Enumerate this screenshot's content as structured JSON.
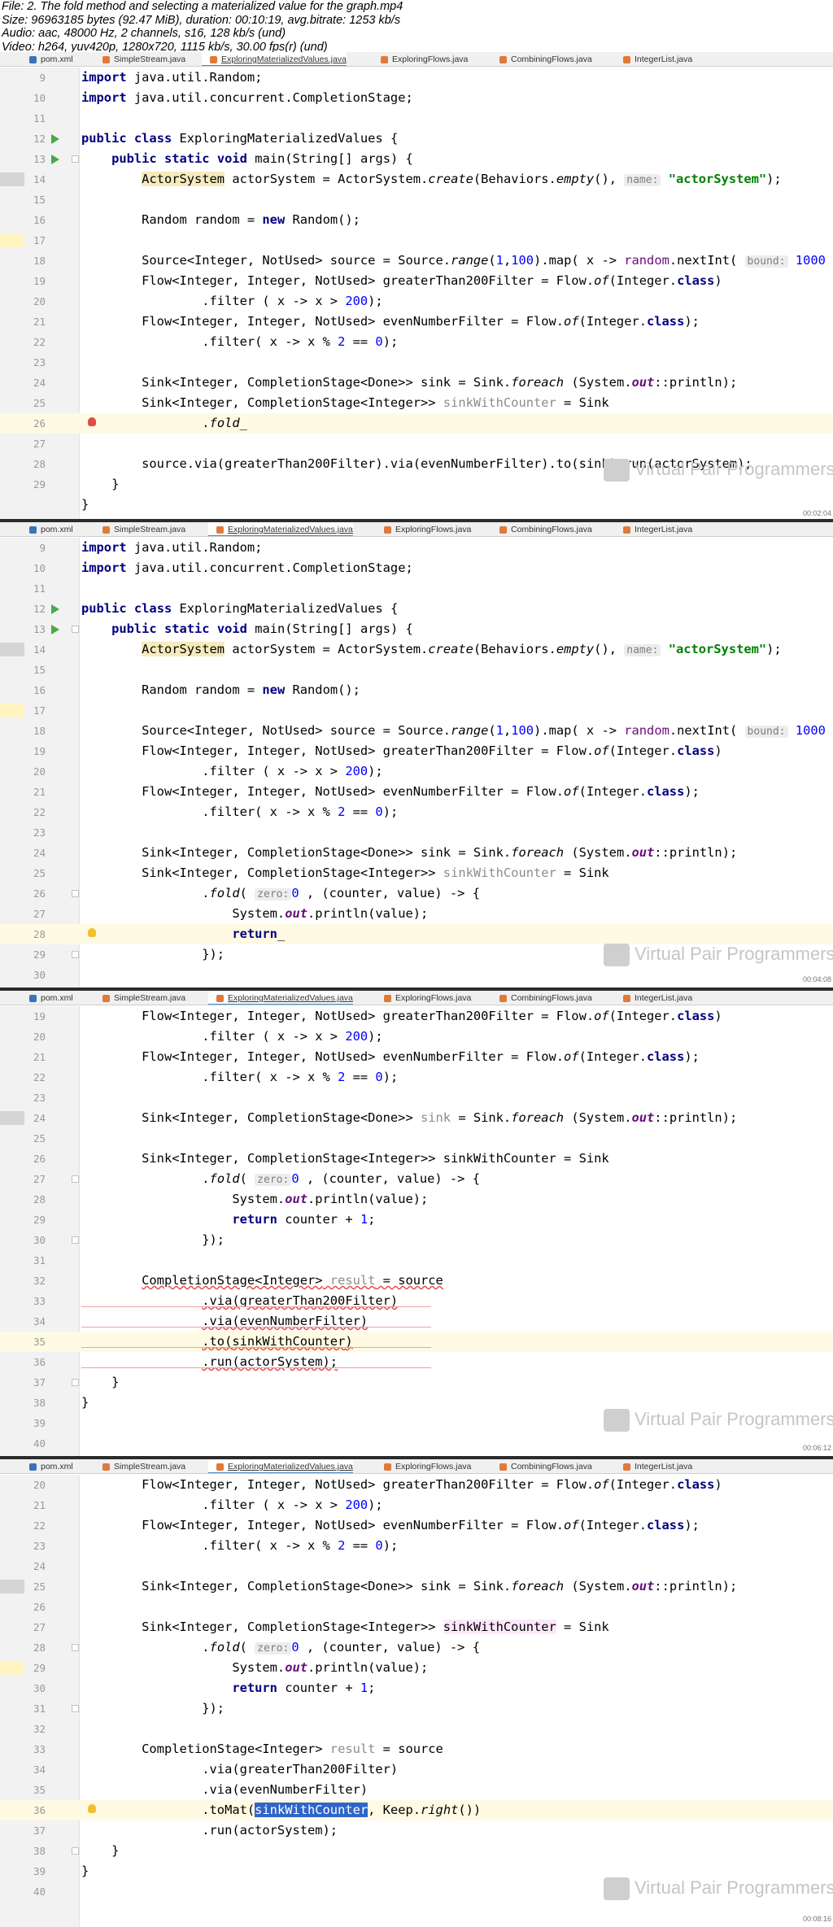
{
  "file_info": [
    "File: 2. The fold method and selecting a materialized value for the graph.mp4",
    "Size: 96963185 bytes (92.47 MiB), duration: 00:10:19, avg.bitrate: 1253 kb/s",
    "Audio: aac, 48000 Hz, 2 channels, s16, 128 kb/s (und)",
    "Video: h264, yuv420p, 1280x720, 1115 kb/s, 30.00 fps(r) (und)"
  ],
  "tabs": [
    "pom.xml",
    "SimpleStream.java",
    "ExploringMaterializedValues.java",
    "ExploringFlows.java",
    "CombiningFlows.java",
    "IntegerList.java"
  ],
  "active_tab": "ExploringMaterializedValues.java",
  "watermark": "Virtual Pair Programmers",
  "timestamps": [
    "00:02:04",
    "00:04:08",
    "00:06:12",
    "00:08:16"
  ],
  "tokens": {
    "import": "import",
    "java_util_random": "java.util.Random;",
    "java_util_cs": "java.util.concurrent.CompletionStage;",
    "public": "public",
    "class": "class",
    "static": "static",
    "void": "void",
    "new": "new",
    "return": "return",
    "class_name": "ExploringMaterializedValues",
    "brace_open": "{",
    "brace_close": "}",
    "main_sig": "main(String[] args) {",
    "ActorSystem": "ActorSystem",
    "actorSystem_eq": "actorSystem = ActorSystem.",
    "create": "create",
    "behaviors": "(Behaviors.",
    "empty": "empty",
    "parens_comma": "(),",
    "hint_name": "name:",
    "actor_str": "\"actorSystem\"",
    "close_semi": ");",
    "random_decl": "Random random = ",
    "random_ctor": "Random();",
    "source_decl": "Source<Integer, NotUsed> source = Source.",
    "range": "range",
    "paren_open": "(",
    "num_1": "1",
    "comma": ",",
    "num_100": "100",
    "map_lambda": ").map( x -> ",
    "random_field": "random",
    "next_int": ".nextInt(",
    "hint_bound": "bound:",
    "num_1000": "1000",
    "flow_decl_gt": "Flow<Integer, Integer, NotUsed> greaterThan200Filter = Flow.",
    "of": "of",
    "integer_paren": "(Integer.",
    "filter_gt": ".filter ( x -> x > ",
    "num_200": "200",
    "flow_decl_even": "Flow<Integer, Integer, NotUsed> evenNumberFilter = Flow.",
    "filter_even": ".filter( x -> x % ",
    "num_2": "2",
    "eq_eq": " == ",
    "num_0": "0",
    "sink_type_done": "Sink<Integer, CompletionStage<Done>> ",
    "sink": "sink",
    "sink_eq": " = Sink.",
    "foreach": "foreach",
    "foreach_open": " (System.",
    "out": "out",
    "println_ref": "::println);",
    "sink_type_int": "Sink<Integer, CompletionStage<Integer>> ",
    "sink_with_counter": "sinkWithCounter",
    "eq_sink": " = Sink",
    "fold_dot": ".",
    "fold": "fold",
    "fold_open": "( ",
    "hint_zero": "zero:",
    "fold_rest": " , (counter, value) -> {",
    "println_value": "System.",
    "println_call": ".println(value);",
    "return_counter": " counter + ",
    "semi": ";",
    "close_brace_paren": "});",
    "underscore": "_",
    "source_via": "source.via(greaterThan200Filter).via(evenNumberFilter).to(sink).run(actorSystem);",
    "cs_type": "CompletionStage<Integer>",
    "result": " result",
    "eq_source": " = source",
    "via_gt": ".via(greaterThan200Filter)",
    "via_even": ".via(evenNumberFilter)",
    "to_open": ".to(",
    "paren_close": ")",
    "run_actor": ".run(actorSystem);",
    "run_a": ".ru",
    "run_b": "n(actorSystem);",
    "to_mat": ".toMat(",
    "keep": ", Keep.",
    "right": "right",
    "parens_close": "())",
    "run_actor_sel_a": ".run(actorSystem)",
    "run_actor_sel_b": ";"
  },
  "panel1": {
    "lines": [
      "9",
      "10",
      "11",
      "12",
      "13",
      "14",
      "15",
      "16",
      "17",
      "18",
      "19",
      "20",
      "21",
      "22",
      "23",
      "24",
      "25",
      "26",
      "27",
      "28",
      "29"
    ]
  },
  "panel2": {
    "lines": [
      "9",
      "10",
      "11",
      "12",
      "13",
      "14",
      "15",
      "16",
      "17",
      "18",
      "19",
      "20",
      "21",
      "22",
      "23",
      "24",
      "25",
      "26",
      "27",
      "28",
      "29",
      "30"
    ]
  },
  "panel3": {
    "lines": [
      "19",
      "20",
      "21",
      "22",
      "23",
      "24",
      "25",
      "26",
      "27",
      "28",
      "29",
      "30",
      "31",
      "32",
      "33",
      "34",
      "35",
      "36",
      "37",
      "38",
      "39",
      "40"
    ]
  },
  "panel4": {
    "lines": [
      "20",
      "21",
      "22",
      "23",
      "24",
      "25",
      "26",
      "27",
      "28",
      "29",
      "30",
      "31",
      "32",
      "33",
      "34",
      "35",
      "36",
      "37",
      "38",
      "39",
      "40"
    ]
  },
  "colors": {
    "keyword": "#000080",
    "number": "#0000ff",
    "string": "#008000",
    "field": "#660e7a",
    "selection": "#2f65ca"
  }
}
